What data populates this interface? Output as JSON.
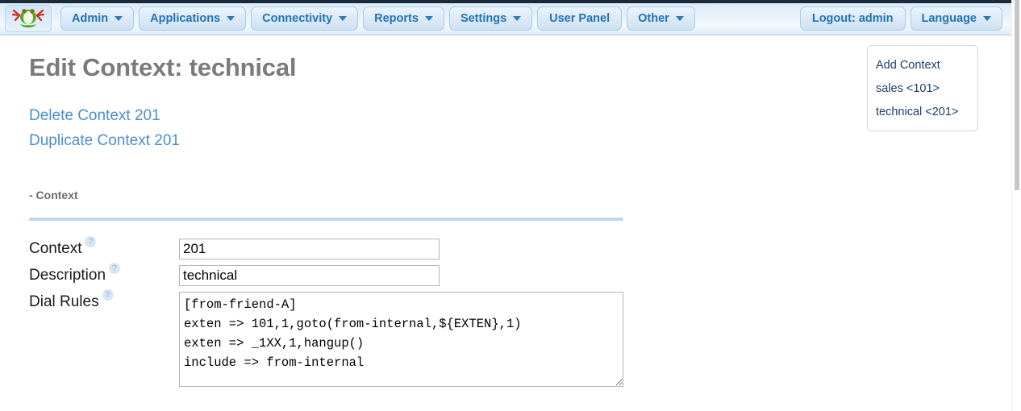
{
  "navbar": {
    "logo_icon": "frog-logo-icon",
    "left_items": [
      {
        "label": "Admin",
        "has_caret": true
      },
      {
        "label": "Applications",
        "has_caret": true
      },
      {
        "label": "Connectivity",
        "has_caret": true
      },
      {
        "label": "Reports",
        "has_caret": true
      },
      {
        "label": "Settings",
        "has_caret": true
      },
      {
        "label": "User Panel",
        "has_caret": false
      },
      {
        "label": "Other",
        "has_caret": true
      }
    ],
    "right_items": [
      {
        "label": "Logout: admin",
        "has_caret": false
      },
      {
        "label": "Language",
        "has_caret": true
      }
    ],
    "accent_color": "#2274b5",
    "background_color": "#e4eff8",
    "top_stripe_color": "#1b2a3a"
  },
  "page": {
    "title": "Edit Context: technical",
    "action_links": [
      "Delete Context 201",
      "Duplicate Context 201"
    ],
    "section_title": "- Context",
    "link_color": "#4a8fce",
    "title_color": "#7b7b7b",
    "divider_color": "#bcd9f0"
  },
  "form": {
    "help_icon": "question-mark-circle-icon",
    "fields": [
      {
        "label": "Context",
        "value": "201",
        "placeholder": ""
      },
      {
        "label": "Description",
        "value": "technical",
        "placeholder": ""
      }
    ],
    "dial_rules": {
      "label": "Dial Rules",
      "value": "[from-friend-A]\nexten => 101,1,goto(from-internal,${EXTEN},1)\nexten => _1XX,1,hangup()\ninclude => from-internal",
      "placeholder": ""
    }
  },
  "side_panel": {
    "items": [
      "Add Context",
      "sales <101>",
      "technical <201>"
    ],
    "text_color": "#1f3b73"
  }
}
